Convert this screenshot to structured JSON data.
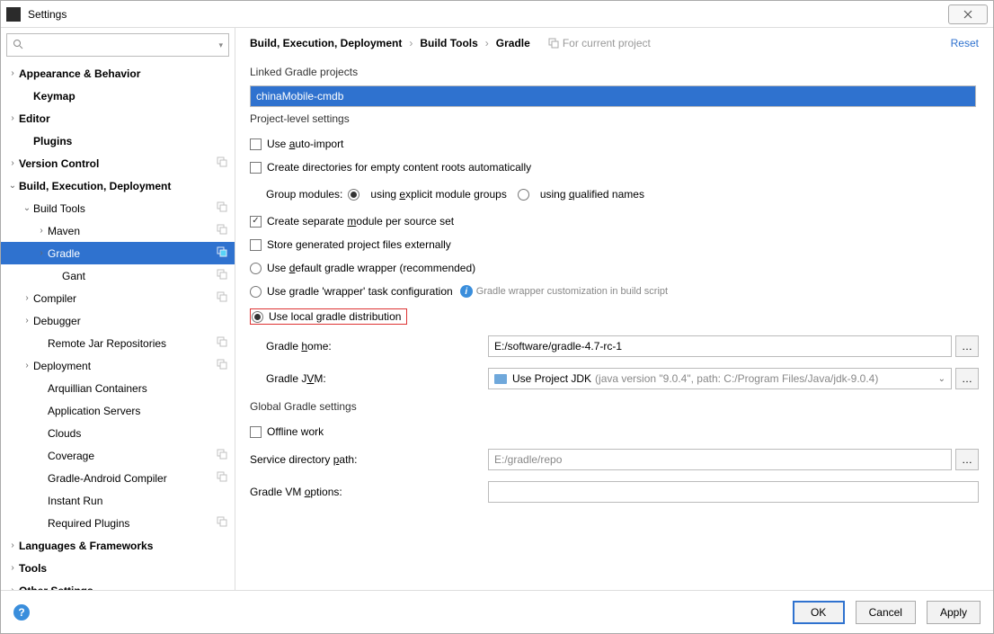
{
  "window": {
    "title": "Settings"
  },
  "search": {
    "placeholder": ""
  },
  "tree": {
    "appearance": "Appearance & Behavior",
    "keymap": "Keymap",
    "editor": "Editor",
    "plugins": "Plugins",
    "vcs": "Version Control",
    "build": "Build, Execution, Deployment",
    "build_tools": "Build Tools",
    "maven": "Maven",
    "gradle": "Gradle",
    "gant": "Gant",
    "compiler": "Compiler",
    "debugger": "Debugger",
    "remote_jar": "Remote Jar Repositories",
    "deployment": "Deployment",
    "arquillian": "Arquillian Containers",
    "app_servers": "Application Servers",
    "clouds": "Clouds",
    "coverage": "Coverage",
    "gradle_android": "Gradle-Android Compiler",
    "instant_run": "Instant Run",
    "required_plugins": "Required Plugins",
    "languages": "Languages & Frameworks",
    "tools": "Tools",
    "other": "Other Settings"
  },
  "breadcrumb": {
    "b1": "Build, Execution, Deployment",
    "b2": "Build Tools",
    "b3": "Gradle",
    "hint": "For current project",
    "reset": "Reset"
  },
  "labels": {
    "linked": "Linked Gradle projects",
    "project_level": "Project-level settings",
    "global": "Global Gradle settings"
  },
  "linkedProject": "chinaMobile-cmdb",
  "settings": {
    "auto_import_pre": "Use ",
    "auto_import_u": "a",
    "auto_import_post": "uto-import",
    "create_dirs": "Create directories for empty content roots automatically",
    "group_modules": "Group modules:",
    "explicit_pre": "using ",
    "explicit_u": "e",
    "explicit_post": "xplicit module groups",
    "qualified": "using qualified names",
    "qualified_u": "q",
    "sep_module_pre": "Create separate ",
    "sep_module_u": "m",
    "sep_module_post": "odule per source set",
    "store_ext": "Store generated project files externally",
    "use_default": "Use default gradle wrapper (recommended)",
    "use_default_u": "d",
    "use_wrapper": "Use gradle 'wrapper' task configuration",
    "wrapper_info": "Gradle wrapper customization in build script",
    "use_local": "Use local gradle distribution",
    "gradle_home": "Gradle home:",
    "gradle_home_u": "h",
    "gradle_home_val": "E:/software/gradle-4.7-rc-1",
    "gradle_jvm": "Gradle JVM:",
    "gradle_jvm_u": "V",
    "jvm_main": "Use Project JDK",
    "jvm_suffix": " (java version \"9.0.4\", path: C:/Program Files/Java/jdk-9.0.4)",
    "offline": "Offline work",
    "service_dir": "Service directory path:",
    "service_dir_u": "p",
    "service_dir_val": "E:/gradle/repo",
    "vm_options": "Gradle VM options:",
    "vm_options_u": "o",
    "vm_options_val": ""
  },
  "footer": {
    "ok": "OK",
    "cancel": "Cancel",
    "apply": "Apply"
  }
}
